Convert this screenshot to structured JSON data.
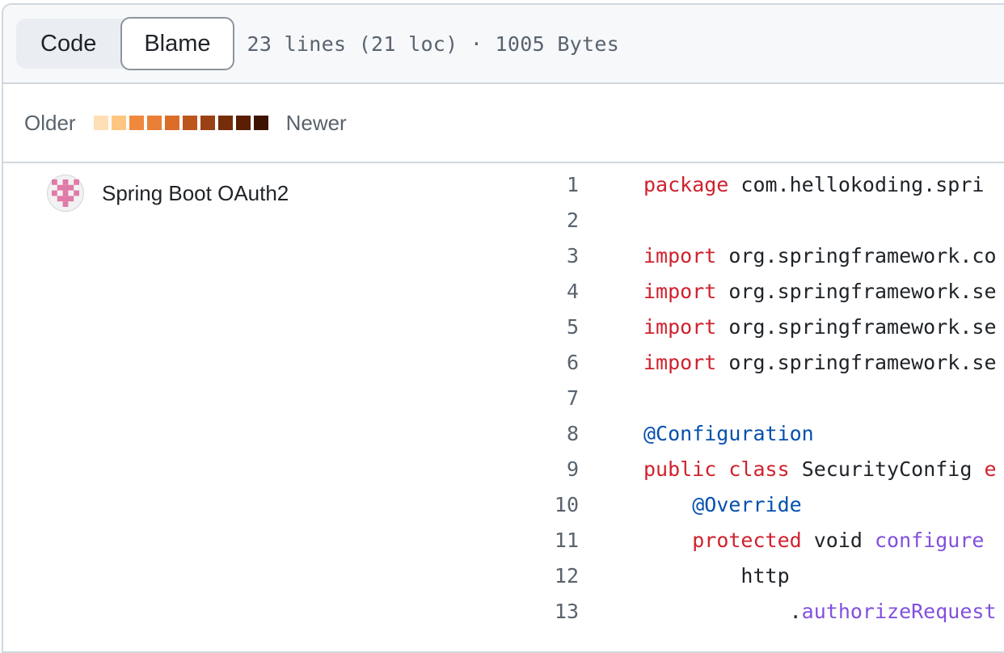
{
  "header": {
    "tabs": [
      {
        "label": "Code",
        "active": false
      },
      {
        "label": "Blame",
        "active": true
      }
    ],
    "file_info": "23 lines (21 loc) · 1005 Bytes"
  },
  "legend": {
    "older_label": "Older",
    "newer_label": "Newer",
    "colors": [
      "#ffdfb6",
      "#ffc680",
      "#f0883e",
      "#e97f36",
      "#db6d28",
      "#bd561d",
      "#9b4215",
      "#762d0a",
      "#5a1e02",
      "#3d1300"
    ]
  },
  "blame": {
    "avatar_icon": "pixel-identicon-icon",
    "commit_message": "Spring Boot OAuth2"
  },
  "code": {
    "lines": [
      {
        "num": "1",
        "tokens": [
          {
            "t": "package",
            "c": "kw"
          },
          {
            "t": " com.hellokoding.spri",
            "c": ""
          }
        ]
      },
      {
        "num": "2",
        "tokens": []
      },
      {
        "num": "3",
        "tokens": [
          {
            "t": "import",
            "c": "kw"
          },
          {
            "t": " org.springframework.co",
            "c": ""
          }
        ]
      },
      {
        "num": "4",
        "tokens": [
          {
            "t": "import",
            "c": "kw"
          },
          {
            "t": " org.springframework.se",
            "c": ""
          }
        ]
      },
      {
        "num": "5",
        "tokens": [
          {
            "t": "import",
            "c": "kw"
          },
          {
            "t": " org.springframework.se",
            "c": ""
          }
        ]
      },
      {
        "num": "6",
        "tokens": [
          {
            "t": "import",
            "c": "kw"
          },
          {
            "t": " org.springframework.se",
            "c": ""
          }
        ]
      },
      {
        "num": "7",
        "tokens": []
      },
      {
        "num": "8",
        "tokens": [
          {
            "t": "@Configuration",
            "c": "ann"
          }
        ]
      },
      {
        "num": "9",
        "tokens": [
          {
            "t": "public",
            "c": "kw"
          },
          {
            "t": " ",
            "c": ""
          },
          {
            "t": "class",
            "c": "kw"
          },
          {
            "t": " SecurityConfig ",
            "c": ""
          },
          {
            "t": "e",
            "c": "kw"
          }
        ]
      },
      {
        "num": "10",
        "tokens": [
          {
            "t": "    ",
            "c": ""
          },
          {
            "t": "@Override",
            "c": "ann"
          }
        ]
      },
      {
        "num": "11",
        "tokens": [
          {
            "t": "    ",
            "c": ""
          },
          {
            "t": "protected",
            "c": "kw"
          },
          {
            "t": " void ",
            "c": ""
          },
          {
            "t": "configure",
            "c": "fn"
          }
        ]
      },
      {
        "num": "12",
        "tokens": [
          {
            "t": "        http",
            "c": ""
          }
        ]
      },
      {
        "num": "13",
        "tokens": [
          {
            "t": "            .",
            "c": ""
          },
          {
            "t": "authorizeRequest",
            "c": "fn"
          }
        ]
      }
    ]
  }
}
